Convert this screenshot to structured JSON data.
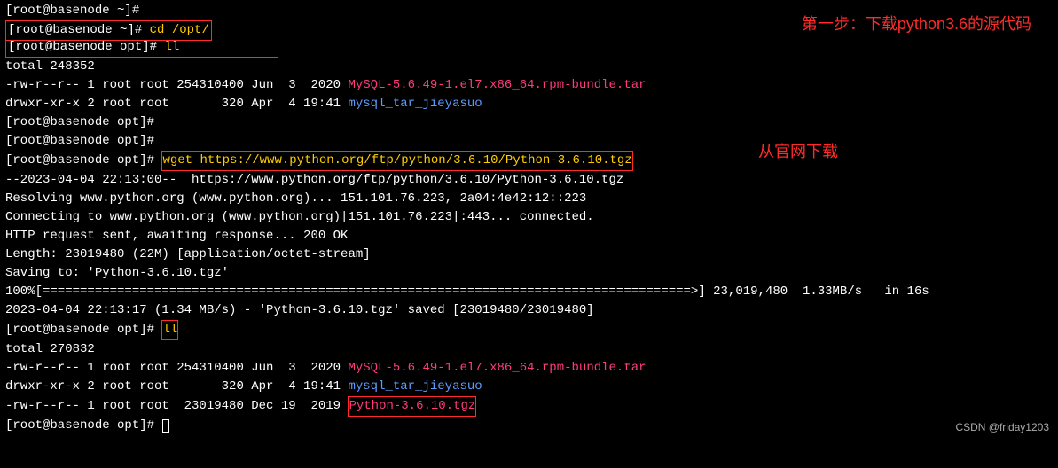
{
  "lines": {
    "l0": "[root@basenode ~]# ",
    "l1": {
      "prompt": "[root@basenode ~]# ",
      "cmd": "cd /opt/"
    },
    "l2": {
      "prompt": "[root@basenode opt]# ",
      "cmd": "ll"
    },
    "l3": "total 248352",
    "l4a": "-rw-r--r-- 1 root root 254310400 Jun  3  2020 ",
    "l4b": "MySQL-5.6.49-1.el7.x86_64.rpm-bundle.tar",
    "l5a": "drwxr-xr-x 2 root root       320 Apr  4 19:41 ",
    "l5b": "mysql_tar_jieyasuo",
    "l6": "[root@basenode opt]#",
    "l7": "[root@basenode opt]#",
    "l8": {
      "prompt": "[root@basenode opt]# ",
      "cmd": "wget https://www.python.org/ftp/python/3.6.10/Python-3.6.10.tgz"
    },
    "l9": "--2023-04-04 22:13:00--  https://www.python.org/ftp/python/3.6.10/Python-3.6.10.tgz",
    "l10": "Resolving www.python.org (www.python.org)... 151.101.76.223, 2a04:4e42:12::223",
    "l11": "Connecting to www.python.org (www.python.org)|151.101.76.223|:443... connected.",
    "l12": "HTTP request sent, awaiting response... 200 OK",
    "l13": "Length: 23019480 (22M) [application/octet-stream]",
    "l14": "Saving to: 'Python-3.6.10.tgz'",
    "l15": "",
    "l16": "100%[=======================================================================================>] 23,019,480  1.33MB/s   in 16s",
    "l17": "",
    "l18": "2023-04-04 22:13:17 (1.34 MB/s) - 'Python-3.6.10.tgz' saved [23019480/23019480]",
    "l19": "",
    "l20": {
      "prompt": "[root@basenode opt]# ",
      "cmd": "ll"
    },
    "l21": "total 270832",
    "l22a": "-rw-r--r-- 1 root root 254310400 Jun  3  2020 ",
    "l22b": "MySQL-5.6.49-1.el7.x86_64.rpm-bundle.tar",
    "l23a": "drwxr-xr-x 2 root root       320 Apr  4 19:41 ",
    "l23b": "mysql_tar_jieyasuo",
    "l24a": "-rw-r--r-- 1 root root  23019480 Dec 19  2019 ",
    "l24b": "Python-3.6.10.tgz",
    "l25": "[root@basenode opt]# "
  },
  "annotations": {
    "step1": "第一步：下载python3.6的源代码",
    "download_from_official": "从官网下载"
  },
  "watermark": "CSDN @friday1203"
}
